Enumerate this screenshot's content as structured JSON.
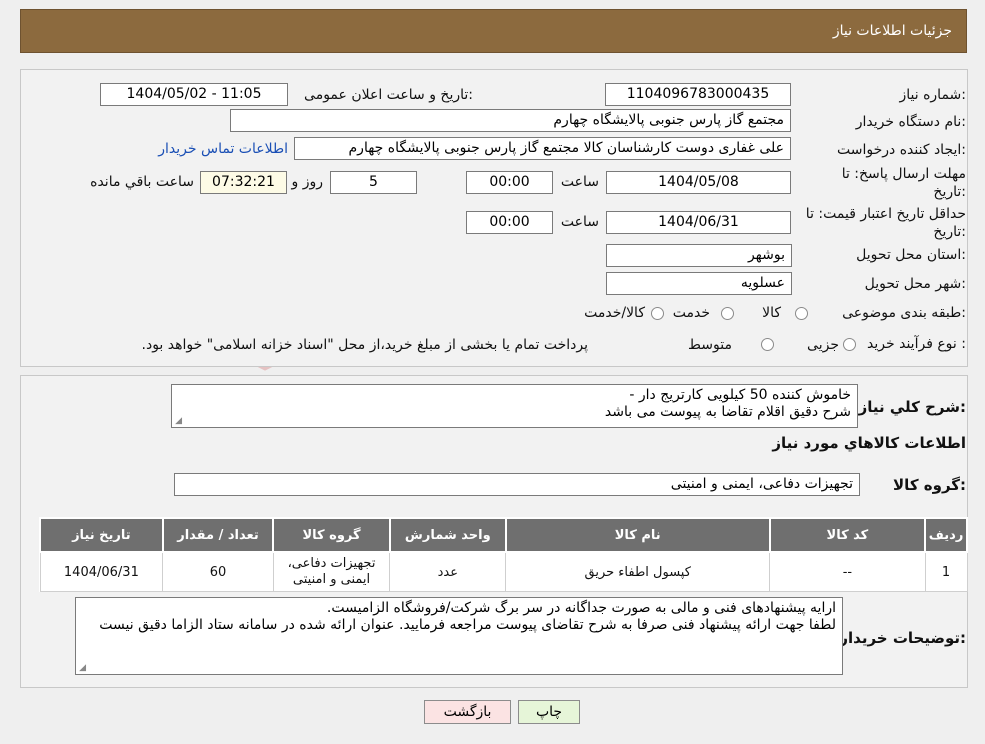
{
  "header": {
    "title": "جزئیات اطلاعات نیاز"
  },
  "watermark": {
    "text": "AriaTender.neT"
  },
  "form": {
    "need_number_label": "شماره نیاز:",
    "need_number": "1104096783000435",
    "announce_label": "تاریخ و ساعت اعلان عمومی:",
    "announce_value": "1404/05/02 - 11:05",
    "buyer_label": "نام دستگاه خریدار:",
    "buyer_value": "مجتمع گاز پارس جنوبی  پالایشگاه چهارم",
    "creator_label": "ایجاد کننده درخواست:",
    "creator_value": "علی غفاری دوست کارشناسان کالا مجتمع گاز پارس جنوبی  پالایشگاه چهارم",
    "contact_link": "اطلاعات تماس خریدار",
    "reply_deadline_label_1": "مهلت ارسال پاسخ: تا",
    "reply_deadline_label_2": "تاریخ:",
    "reply_date": "1404/05/08",
    "time_label": "ساعت",
    "reply_time": "00:00",
    "days_value": "5",
    "days_label": "روز و",
    "remaining_time": "07:32:21",
    "remaining_label": "ساعت باقي مانده",
    "validity_label_1": "حداقل تاریخ اعتبار قیمت: تا",
    "validity_label_2": "تاریخ:",
    "validity_date": "1404/06/31",
    "validity_time": "00:00",
    "province_label": "استان محل تحویل:",
    "province_value": "بوشهر",
    "city_label": "شهر محل تحویل:",
    "city_value": "عسلویه",
    "category_label": "طبقه بندی موضوعی:",
    "category_options": [
      "کالا",
      "خدمت",
      "کالا/خدمت"
    ],
    "process_label": "نوع فرآیند خرید :",
    "process_options": [
      "جزیی",
      "متوسط"
    ],
    "process_note": "پرداخت تمام یا بخشی از مبلغ خرید،از محل \"اسناد خزانه اسلامی\" خواهد بود."
  },
  "description": {
    "label": "شرح کلي نياز:",
    "line1": "خاموش کننده 50 کیلویی کارتریج دار -",
    "line2": "شرح دقیق اقلام تقاضا به پیوست می باشد"
  },
  "goods": {
    "section_title": "اطلاعات کالاهاي مورد نياز",
    "group_label": "گروه کالا:",
    "group_value": "تجهیزات دفاعی، ایمنی و امنیتی"
  },
  "table": {
    "headers": [
      "رديف",
      "کد کالا",
      "نام کالا",
      "واحد شمارش",
      "گروه کالا",
      "تعداد / مقدار",
      "تاریخ نیاز"
    ],
    "rows": [
      [
        "1",
        "--",
        "کپسول اطفاء حریق",
        "عدد",
        "تجهیزات دفاعی، ایمنی و امنیتی",
        "60",
        "1404/06/31"
      ]
    ]
  },
  "buyer_notes": {
    "label": "توضیحات خریدار:",
    "line1": "ارایه پیشنهادهای فنی و مالی به صورت جداگانه در سر برگ شرکت/فروشگاه الزامیست.",
    "line2": "لطفا جهت ارائه پیشنهاد فنی صرفا به شرح تقاضای پیوست مراجعه فرمایید. عنوان ارائه شده در سامانه ستاد الزاما دقیق نیست"
  },
  "buttons": {
    "print": "چاپ",
    "back": "بازگشت"
  },
  "colors": {
    "header_bg": "#8c6a3e",
    "link": "#1a4fb5",
    "print_bg": "#e6f5d8",
    "back_bg": "#fbe3e3"
  }
}
